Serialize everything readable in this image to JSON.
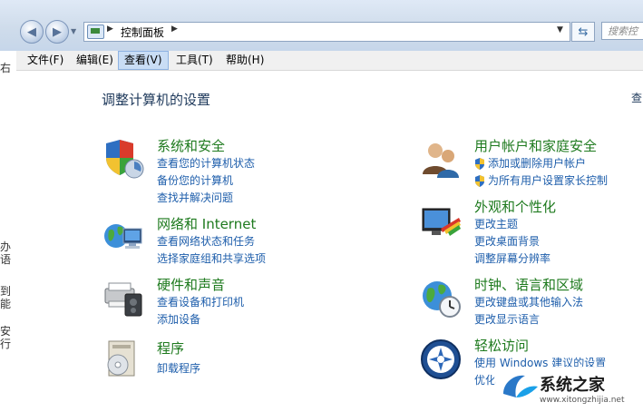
{
  "address_bar": {
    "breadcrumb": "控制面板",
    "search_placeholder": "搜索控"
  },
  "menu": {
    "items": [
      "文件(F)",
      "编辑(E)",
      "查看(V)",
      "工具(T)",
      "帮助(H)"
    ]
  },
  "page": {
    "title": "调整计算机的设置",
    "view_by_fragment": "查"
  },
  "categories_left": [
    {
      "title": "系统和安全",
      "icon": "system-security-icon",
      "links": [
        "查看您的计算机状态",
        "备份您的计算机",
        "查找并解决问题"
      ]
    },
    {
      "title": "网络和 Internet",
      "icon": "network-internet-icon",
      "links": [
        "查看网络状态和任务",
        "选择家庭组和共享选项"
      ]
    },
    {
      "title": "硬件和声音",
      "icon": "hardware-sound-icon",
      "links": [
        "查看设备和打印机",
        "添加设备"
      ]
    },
    {
      "title": "程序",
      "icon": "programs-icon",
      "links": [
        "卸载程序"
      ]
    }
  ],
  "categories_right": [
    {
      "title": "用户帐户和家庭安全",
      "icon": "user-accounts-icon",
      "links": [
        "添加或删除用户帐户",
        "为所有用户设置家长控制"
      ]
    },
    {
      "title": "外观和个性化",
      "icon": "appearance-icon",
      "links": [
        "更改主题",
        "更改桌面背景",
        "调整屏幕分辨率"
      ]
    },
    {
      "title": "时钟、语言和区域",
      "icon": "clock-language-region-icon",
      "links": [
        "更改键盘或其他输入法",
        "更改显示语言"
      ]
    },
    {
      "title": "轻松访问",
      "icon": "ease-of-access-icon",
      "links": [
        "使用 Windows 建议的设置",
        "优化"
      ]
    }
  ],
  "left_edge_fragments": [
    "右",
    "办",
    "语",
    "到",
    "能",
    "安",
    "行"
  ],
  "watermark": {
    "title": "系统之家",
    "url": "www.xitongzhijia.net"
  },
  "colors": {
    "category_title": "#1e7a1e",
    "link": "#1e5eab",
    "page_title": "#1e395b"
  }
}
